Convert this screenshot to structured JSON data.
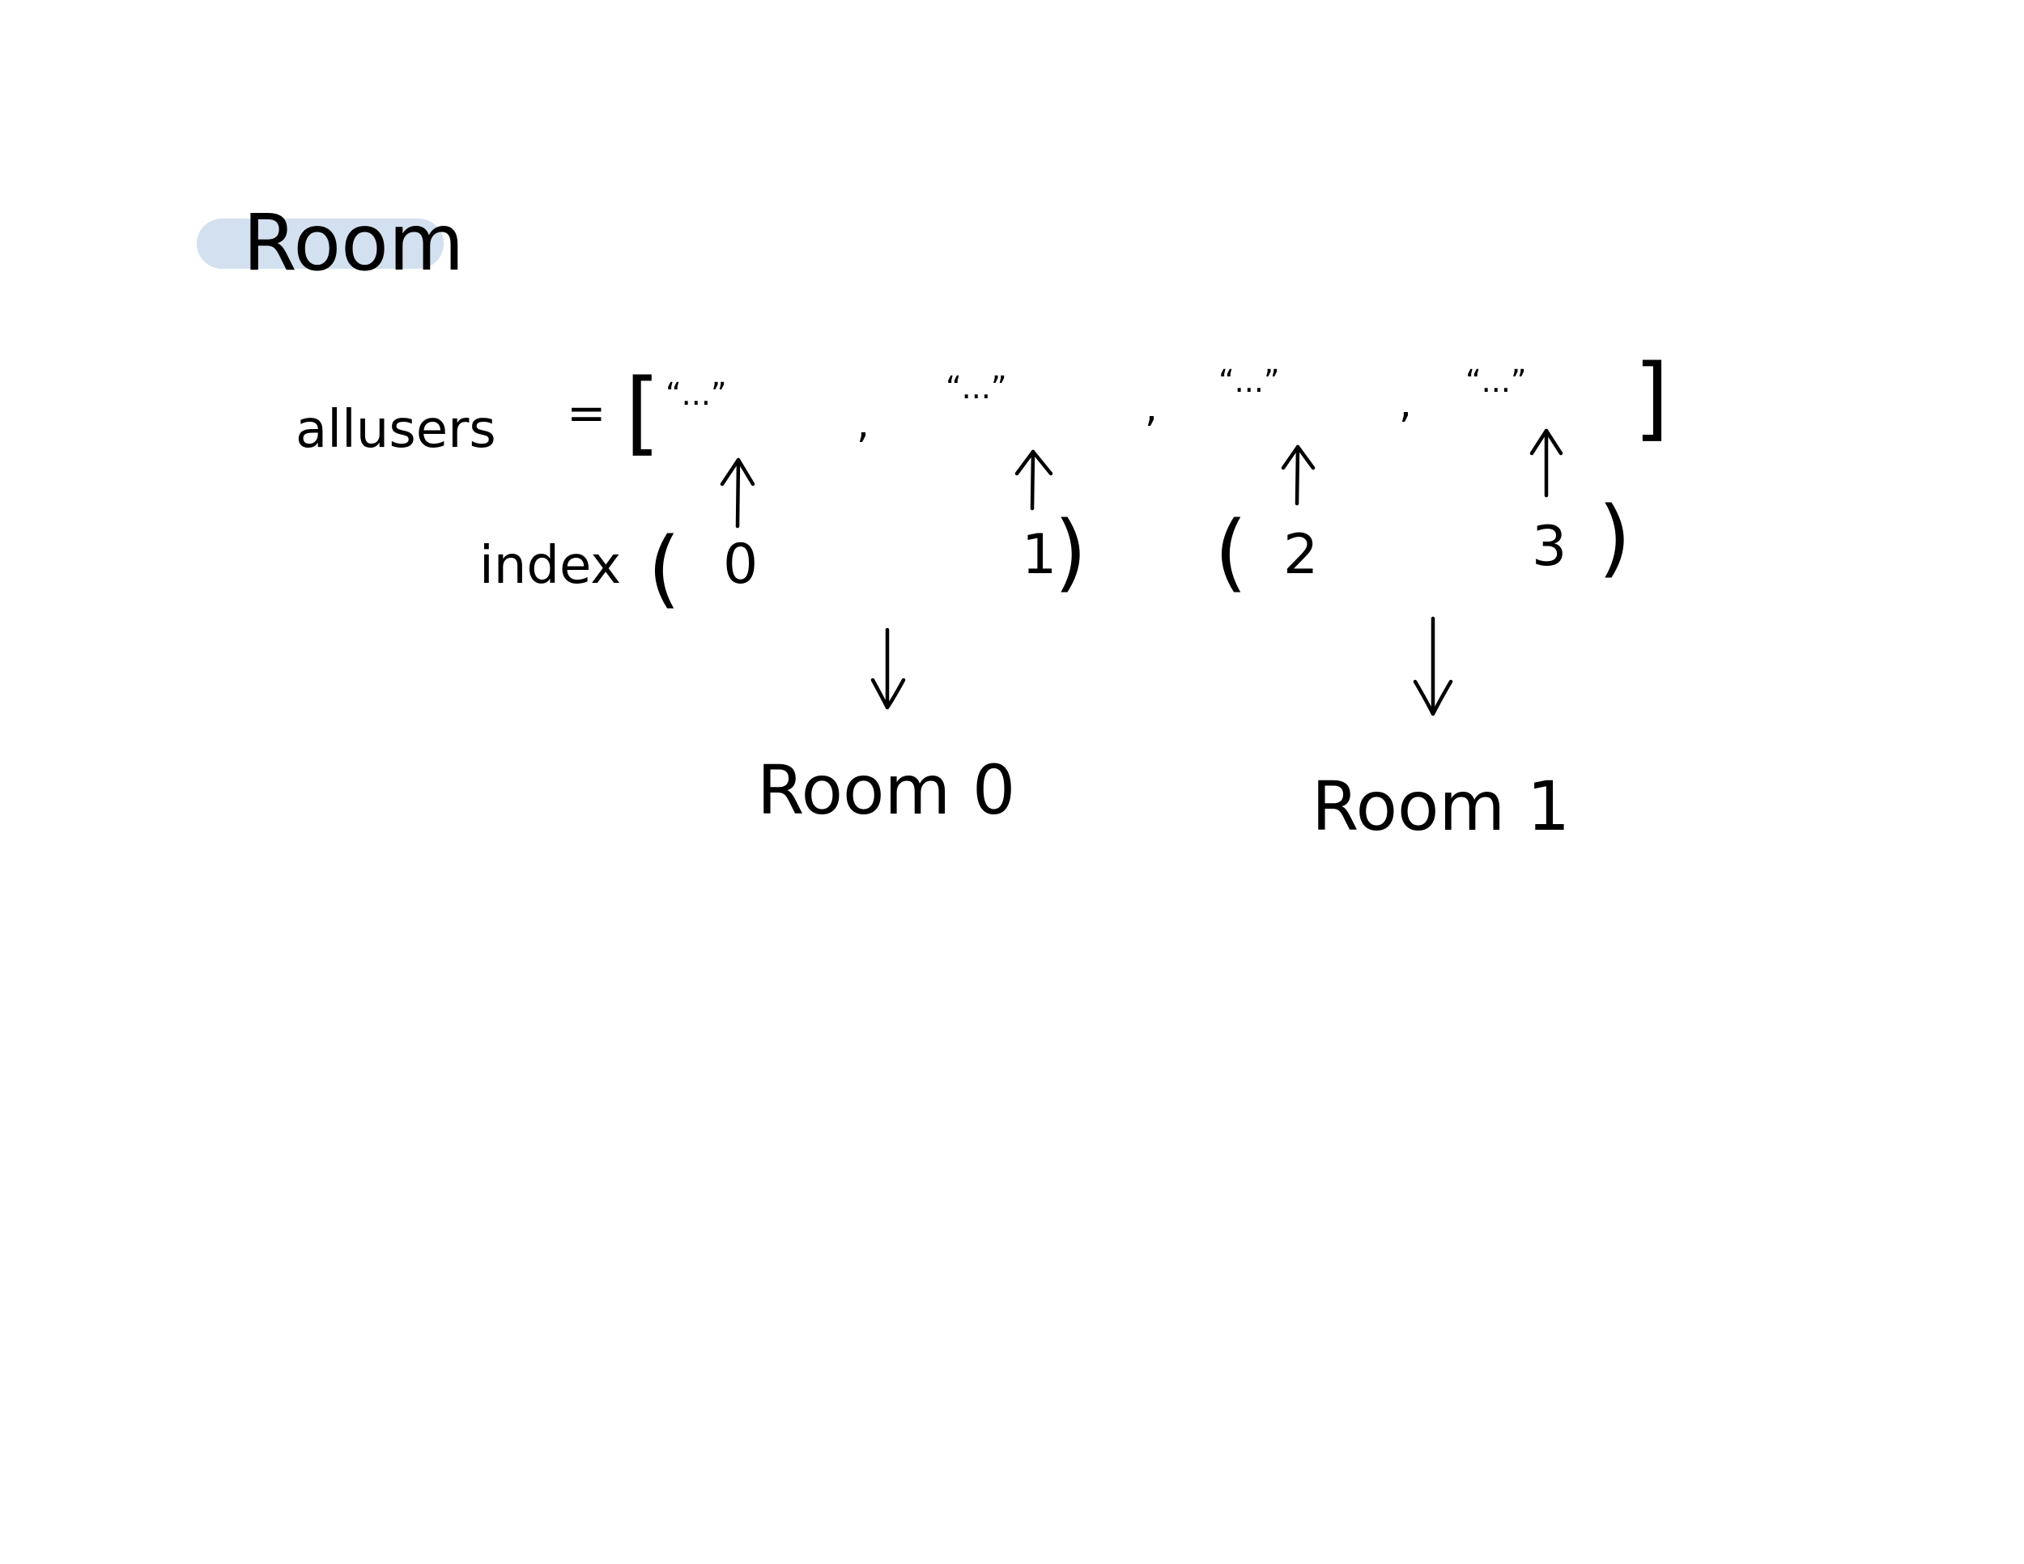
{
  "title": "Room",
  "colors": {
    "highlight": "#d3e0ef",
    "ink": "#000000",
    "background": "#ffffff"
  },
  "array": {
    "name": "allusers",
    "assign": "=",
    "open_bracket": "[",
    "close_bracket": "]",
    "elements": [
      "“...”",
      "“...”",
      "“...”",
      "“...”"
    ],
    "separator": ","
  },
  "index": {
    "label": "index",
    "values": [
      "0",
      "1",
      "2",
      "3"
    ],
    "open_paren": "(",
    "close_paren": ")"
  },
  "rooms": [
    {
      "label": "Room 0"
    },
    {
      "label": "Room 1"
    }
  ]
}
